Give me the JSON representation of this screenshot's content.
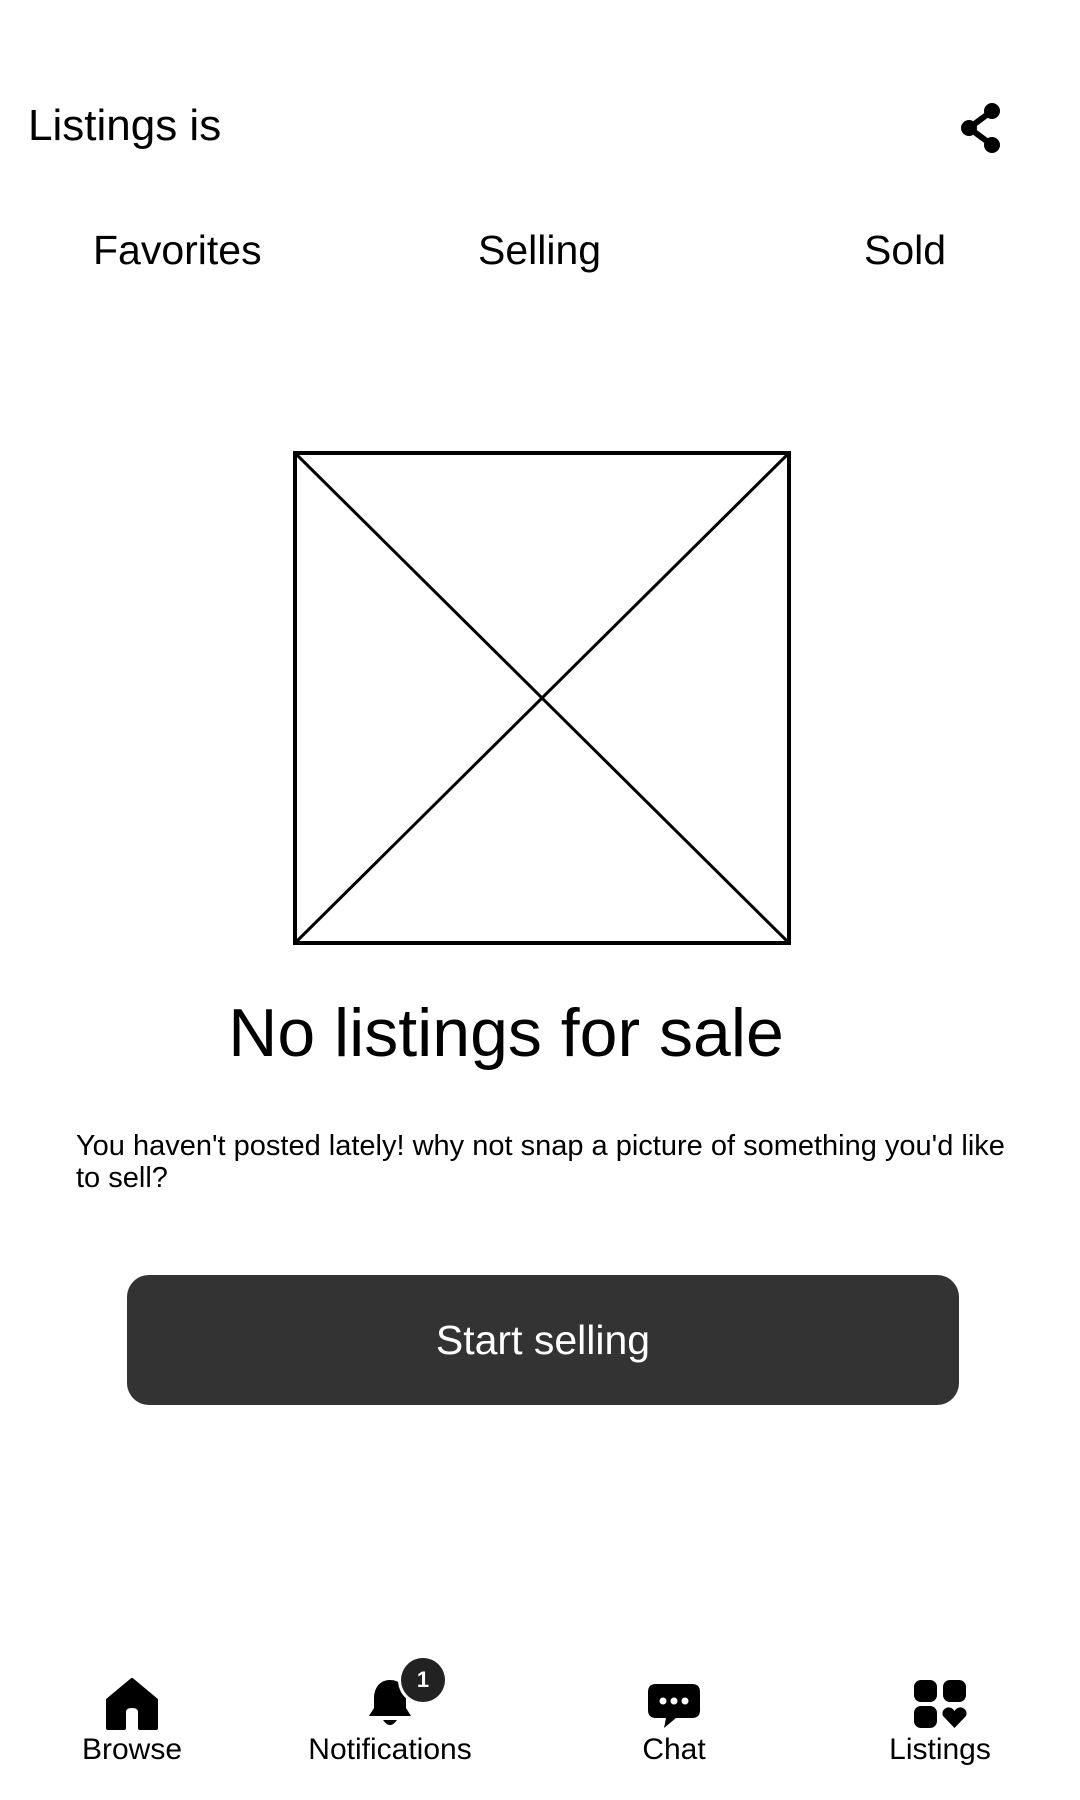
{
  "header": {
    "title": "Listings is",
    "share_icon": "share-icon"
  },
  "tabs": [
    {
      "label": "Favorites"
    },
    {
      "label": "Selling"
    },
    {
      "label": "Sold"
    }
  ],
  "empty_state": {
    "image_icon": "image-placeholder-icon",
    "title": "No listings for sale",
    "body": "You haven't posted lately! why not snap a picture of something you'd like to sell?",
    "cta_label": "Start selling"
  },
  "bottom_nav": {
    "items": [
      {
        "label": "Browse",
        "icon": "home-icon"
      },
      {
        "label": "Notifications",
        "icon": "bell-icon",
        "badge": "1"
      },
      {
        "label": "Chat",
        "icon": "chat-bubble-icon"
      },
      {
        "label": "Listings",
        "icon": "listings-grid-icon"
      }
    ]
  },
  "colors": {
    "cta_background": "#333333",
    "cta_text": "#ffffff",
    "text": "#000000",
    "background": "#ffffff"
  }
}
